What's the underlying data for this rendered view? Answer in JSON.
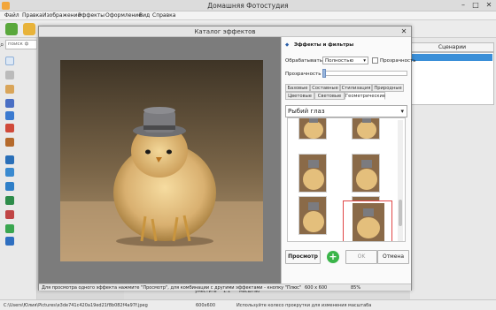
{
  "app": {
    "title": "Домашняя Фотостудия"
  },
  "menu": [
    "Файл",
    "Правка",
    "Изображение",
    "Эффекты",
    "Оформление",
    "Вид",
    "Справка"
  ],
  "left_panel": {
    "search_placeholder": "поиск ф"
  },
  "right_panel": {
    "scenarios_tab": "Сценарии"
  },
  "status": {
    "path": "C:\\Users\\Юлия\\Pictures\\e3de741c420a19ed21f8b082f4a97f.jpeg",
    "size": "600x600",
    "hint": "Используйте колесо прокрутки для изменения масштаба"
  },
  "bottom_bar": {
    "fit": "уместить",
    "one": "1:1",
    "zoom": "масштаб"
  },
  "dialog": {
    "title": "Каталог эффектов",
    "section_title": "Эффекты и фильтры",
    "process_label": "Обрабатывать:",
    "process_value": "Полностью",
    "transparency_checkbox": "Прозрачность",
    "transparency_label": "Прозрачность",
    "tabs_row1": [
      "Базовые",
      "Составные",
      "Стилизация",
      "Природные"
    ],
    "tabs_row2": [
      "Цветовые",
      "Световые",
      "Геометрические"
    ],
    "active_tab": "Геометрические",
    "effect_select": "Рыбий глаз",
    "buttons": {
      "preview": "Просмотр",
      "ok": "OK",
      "cancel": "Отмена"
    },
    "status_hint": "Для просмотра одного эффекта нажмите \"Просмотр\", для комбинации с другими эффектами - кнопку \"Плюс\"",
    "status_size": "600 x 600",
    "status_zoom": "85%"
  },
  "colors": {
    "selection": "#3a8fd8",
    "plus": "#3bb54a",
    "thumb_selected_border": "#e04646"
  },
  "icons": [
    "search-icon",
    "close-icon",
    "plus-icon",
    "chevron-down-icon",
    "pin-icon"
  ]
}
